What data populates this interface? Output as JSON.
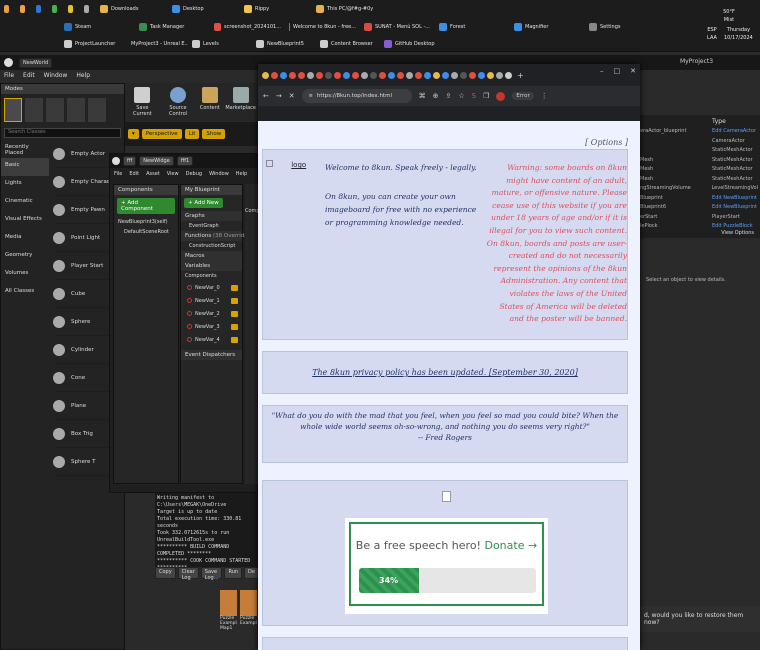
{
  "taskbar": {
    "row1": [
      {
        "label": "",
        "color": "#e7a03a"
      },
      {
        "label": "",
        "color": "#f0a04b"
      },
      {
        "label": "",
        "color": "#2f75d8"
      },
      {
        "label": "",
        "color": "#4caf50"
      },
      {
        "label": "",
        "color": "#e2c234"
      },
      {
        "label": "",
        "color": "#aaaaaa"
      },
      {
        "label": "Downloads",
        "color": "#e6b24a"
      },
      {
        "label": "Desktop",
        "color": "#3d8ee8"
      },
      {
        "label": "Rippy",
        "color": "#f3c44a"
      },
      {
        "label": "This PC/@f#g-#0y",
        "color": "#e6b24a"
      }
    ],
    "row2": [
      {
        "label": "Steam",
        "color": "#2a6fb7"
      },
      {
        "label": "Task Manager",
        "color": "#3a8c4f"
      },
      {
        "label": "screenshot_2024101...",
        "color": "#e04f3f"
      },
      {
        "label": "Welcome to 8kun - free...",
        "color": "#e04f3f"
      },
      {
        "label": "SUNAT - Menú SOL -...",
        "color": "#d94a3e"
      },
      {
        "label": "Forest",
        "color": "#3d8ee8"
      },
      {
        "label": "Magnifier",
        "color": "#3d8ee8"
      },
      {
        "label": "Settings",
        "color": "#888"
      }
    ],
    "row3": [
      {
        "label": "ProjectLauncher",
        "color": "#cccccc"
      },
      {
        "label": "MyProject3 - Unreal E...",
        "color": "#cccccc"
      },
      {
        "label": "Levels",
        "color": "#cccccc"
      },
      {
        "label": "NewBlueprint5",
        "color": "#cccccc"
      },
      {
        "label": "Content Browser",
        "color": "#cccccc"
      },
      {
        "label": "GitHub Desktop",
        "color": "#8a5cd1"
      }
    ],
    "tray": {
      "lang1": "ESP",
      "lang2": "LAA",
      "temp": "50°F",
      "weather": "Mist",
      "time": "Thursday",
      "date": "10/17/2024"
    }
  },
  "ue": {
    "world_tab": "NewWorld",
    "project": "MyProject3",
    "menu": [
      "File",
      "Edit",
      "Window",
      "Help"
    ],
    "modes": "Modes",
    "search_placeholder": "Search Classes",
    "categories": [
      "Recently Placed",
      "Basic",
      "Lights",
      "Cinematic",
      "Visual Effects",
      "Media",
      "Geometry",
      "Volumes",
      "All Classes"
    ],
    "place_items": [
      "Empty Actor",
      "Empty Character",
      "Empty Pawn",
      "Point Light",
      "Player Start",
      "Cube",
      "Sphere",
      "Cylinder",
      "Cone",
      "Plane",
      "Box Trig",
      "Sphere T"
    ],
    "toolbar": [
      "Save Current",
      "Source Control",
      "Content",
      "Marketplace"
    ],
    "viewport_buttons": [
      "Perspective",
      "Lit",
      "Show"
    ],
    "bp": {
      "tabs": [
        "fff",
        "NewWidge",
        "fff1"
      ],
      "menu": [
        "File",
        "Edit",
        "Asset",
        "View",
        "Debug",
        "Window",
        "Help"
      ],
      "components_title": "Components",
      "add_component": "+ Add Component",
      "root": "NewBlueprint3(self)",
      "scene_root": "DefaultSceneRoot",
      "my_blueprint": "My Blueprint",
      "add_new": "+ Add New",
      "sections": [
        "Graphs",
        "EventGraph",
        "Functions",
        "ConstructionScript",
        "Macros",
        "Variables",
        "Components"
      ],
      "functions_override": "(38 Overridab",
      "vars": [
        "NewVar_0",
        "NewVar_1",
        "NewVar_2",
        "NewVar_3",
        "NewVar_4"
      ],
      "event_dispatchers": "Event Dispatchers",
      "comp_label": "Comp"
    },
    "log": [
      "Writing manifest to C:\\Users\\MEGAK\\OneDrive",
      "Target is up to date",
      "Total execution time: 330.81 seconds",
      "Took 332.0712615s to run UnrealBuildTool.exe",
      "********** BUILD COMMAND COMPLETED ********",
      "********** COOK COMMAND STARTED **********",
      "HasMaxsToCook ******** NewWorld+PuzzleE"
    ],
    "log_buttons": [
      "Copy",
      "Clear Log",
      "Save Log...",
      "Run",
      "De"
    ],
    "details_type": "Type",
    "details": [
      {
        "a": "eraActor_blueprint",
        "b": "Edit CameraActor"
      },
      {
        "a": "",
        "b": "CameraActor"
      },
      {
        "a": "",
        "b": "StaticMeshActor"
      },
      {
        "a": "Mesh",
        "b": "StaticMeshActor"
      },
      {
        "a": "Mesh",
        "b": "StaticMeshActor"
      },
      {
        "a": "Mesh",
        "b": "StaticMeshActor"
      },
      {
        "a": "ngStreamingVolume",
        "b": "LevelStreamingVol"
      },
      {
        "a": "Blueprint",
        "b": "Edit NewBlueprint"
      },
      {
        "a": "Blueprint6",
        "b": "Edit NewBlueprint"
      },
      {
        "a": "erStart",
        "b": "PlayerStart"
      },
      {
        "a": "lePlock",
        "b": "Edit PuzzleBlock"
      }
    ],
    "view_options": "View Options",
    "select_hint": "Select an object to view details.",
    "restore_prompt": "d, would you like to restore them now?",
    "puzzle_items": [
      "Puzzle Exampl Map1",
      "Puzzle Exampl"
    ]
  },
  "browser": {
    "url": "https://8kun.top/index.html",
    "profile": "Error",
    "page": {
      "options_link": "[ Options ]",
      "logo_alt": "logo",
      "welcome": "Welcome to 8kun. Speak freely - legally.",
      "create": "On 8kun, you can create your own imageboard for free with no experience or programming knowledge needed.",
      "warning": "Warning: some boards on 8kun might have content of an adult, mature, or offensive nature. Please cease use of this website if you are under 18 years of age and/or if it is illegal for you to view such content. On 8kun, boards and posts are user-created and do not necessarily represent the opinions of the 8kun Administration. Any content that violates the laws of the United States of America will be deleted and the poster will be banned.",
      "privacy": "The 8kun privacy policy has been updated. [September 30, 2020]",
      "quote": "\"What do you do with the mad that you feel, when you feel so mad you could bite? When the whole wide world seems oh-so-wrong, and nothing you do seems very right?\"",
      "quote_author": "-- Fred Rogers",
      "donate_text": "Be a free speech hero!",
      "donate_link": "Donate →",
      "progress_label": "34%",
      "progress_value": 0.34,
      "accent": "#2f8f4e",
      "warning_color": "#d9505f",
      "text_color": "#223366"
    }
  }
}
